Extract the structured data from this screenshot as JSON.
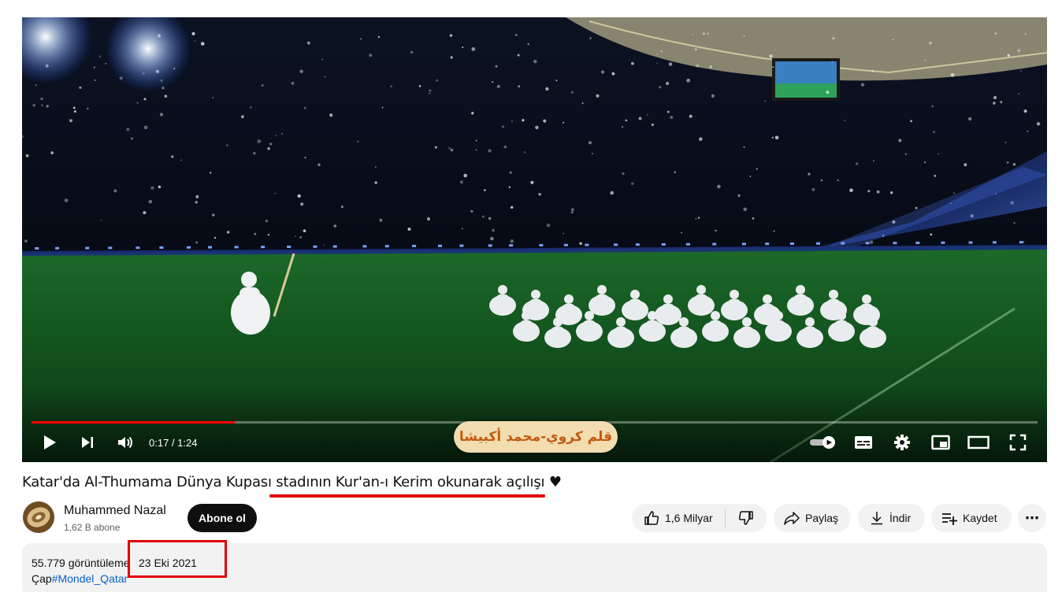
{
  "player": {
    "current_time": "0:17",
    "duration": "1:24",
    "time_display": "0:17 / 1:24",
    "progress_fraction": 0.2024,
    "watermark_text": "قلم كروي-محمد أكبيشا",
    "progress_color": "#ff0000",
    "controls": [
      "play-icon",
      "next-icon",
      "volume-icon",
      "autoplay-toggle-icon",
      "subtitles-icon",
      "settings-gear-icon",
      "miniplayer-icon",
      "theater-mode-icon",
      "fullscreen-icon"
    ]
  },
  "video": {
    "title": "Katar'da Al-Thumama Dünya Kupası stadının Kur'an-ı Kerim okunarak açılışı ♥"
  },
  "channel": {
    "name": "Muhammed Nazal",
    "subscribers": "1,62 B abone",
    "subscribe_label": "Abone ol"
  },
  "actions": {
    "like_count": "1,6 Milyar",
    "share_label": "Paylaş",
    "download_label": "İndir",
    "save_label": "Kaydet",
    "more_label": "⋯"
  },
  "description": {
    "views": "55.779 görüntüleme",
    "date": "23 Eki 2021",
    "tag_prefix": "Çap",
    "tag": "#Mondel_Qatar"
  },
  "annotations": {
    "highlight_color": "#e00000"
  }
}
